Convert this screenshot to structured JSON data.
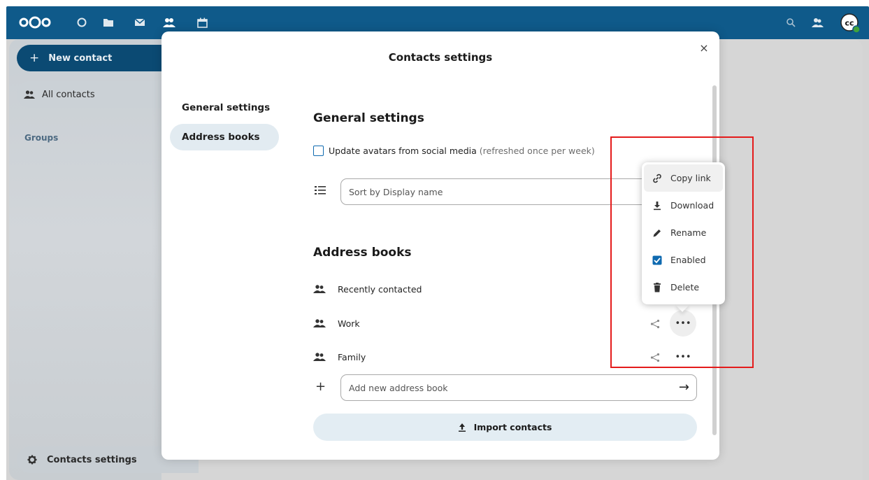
{
  "topbar": {
    "apps": [
      "logo-icon",
      "dashboard-icon",
      "files-icon",
      "mail-icon",
      "contacts-icon",
      "calendar-icon"
    ],
    "right": [
      "search-icon",
      "contacts-menu-icon"
    ],
    "avatar_initials": "cc",
    "color": "#0f5a8a"
  },
  "sidebar": {
    "new_contact": "New contact",
    "all_contacts": "All contacts",
    "groups": "Groups",
    "settings": "Contacts settings"
  },
  "modal": {
    "title": "Contacts settings",
    "close": "×",
    "nav": [
      {
        "label": "General settings",
        "active": false
      },
      {
        "label": "Address books",
        "active": true
      }
    ],
    "general": {
      "title": "General settings",
      "avatar_checkbox_label": "Update avatars from social media",
      "avatar_checkbox_hint": "(refreshed once per week)",
      "avatar_checked": false,
      "sort_value": "Sort by Display name"
    },
    "address_books": {
      "title": "Address books",
      "items": [
        {
          "name": "Recently contacted"
        },
        {
          "name": "Work"
        },
        {
          "name": "Family"
        }
      ],
      "add_placeholder": "Add new address book",
      "import_label": "Import contacts"
    }
  },
  "context_menu": {
    "items": [
      {
        "label": "Copy link",
        "icon": "link-icon"
      },
      {
        "label": "Download",
        "icon": "download-icon"
      },
      {
        "label": "Rename",
        "icon": "pencil-icon"
      },
      {
        "label": "Enabled",
        "icon": "checkbox-checked-icon",
        "checked": true
      },
      {
        "label": "Delete",
        "icon": "trash-icon"
      }
    ]
  },
  "colors": {
    "accent": "#0f6ab0",
    "primary_dark": "#0b4a73",
    "highlight": "#e41b1b"
  }
}
